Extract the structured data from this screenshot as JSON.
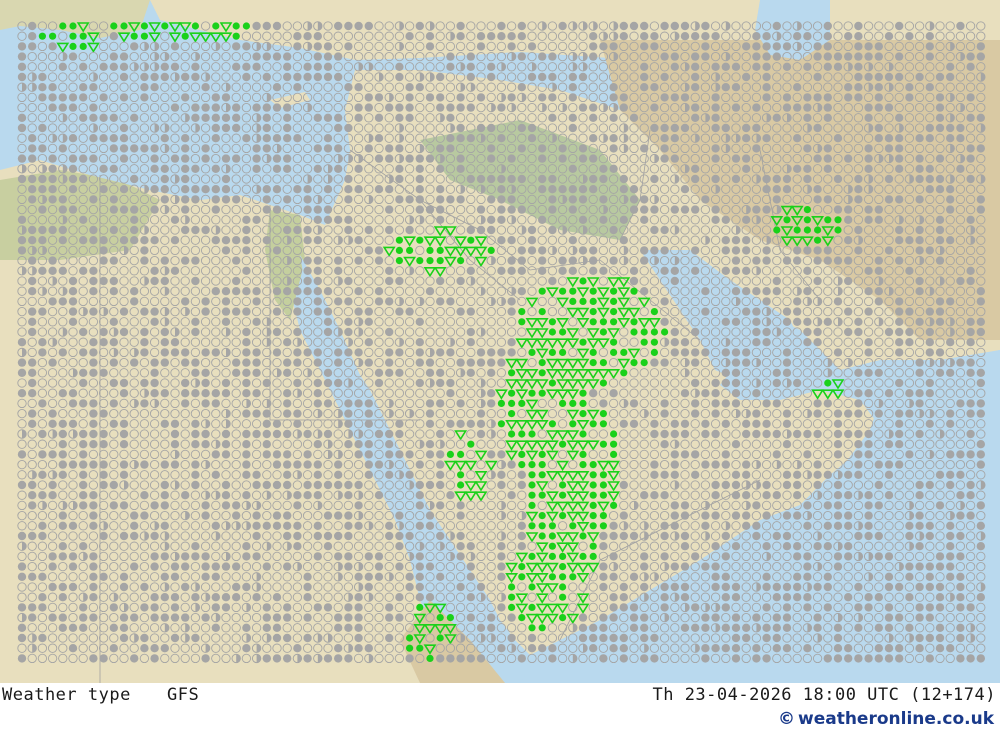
{
  "footer": {
    "parameter_label": "Weather type",
    "model_label": "GFS",
    "valid_time": "Th 23-04-2026 18:00 UTC (12+174)",
    "credit_symbol": "©",
    "credit": "weatheronline.co.uk"
  },
  "colors": {
    "sea": "#b9d9ee",
    "land_lowland": "#e8dfbe",
    "land_green": "#b8c9a0",
    "highland": "#d9c9a3",
    "border": "#a0a0a0",
    "cloud_symbol": "#a5a5a5",
    "precip_symbol": "#1ad11a",
    "footer_text": "#1a1a1a",
    "credit_text": "#1a3a8a"
  },
  "legend_symbols": {
    "open_circle": "clear-sky",
    "half_filled_circle": "partly-cloudy",
    "filled_circle": "overcast",
    "green_dot": "rain",
    "green_triangle": "showers"
  }
}
